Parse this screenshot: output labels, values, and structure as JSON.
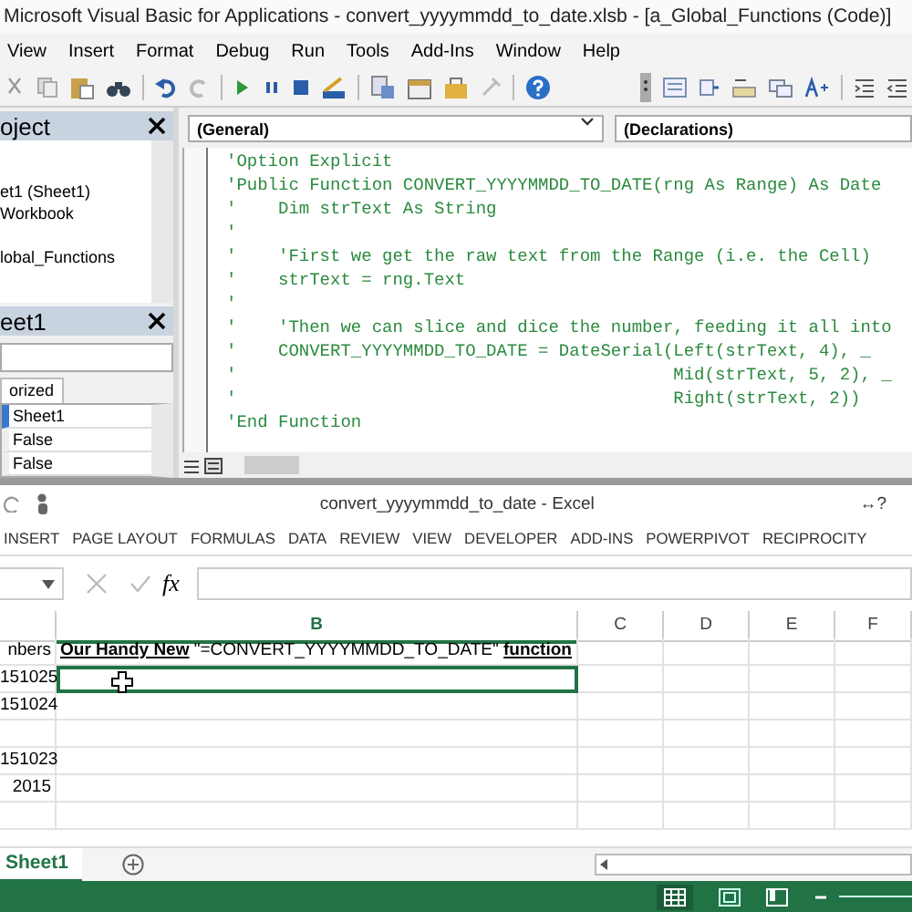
{
  "vba": {
    "title": "Microsoft Visual Basic for Applications - convert_yyyymmdd_to_date.xlsb - [a_Global_Functions (Code)]",
    "menu": [
      "View",
      "Insert",
      "Format",
      "Debug",
      "Run",
      "Tools",
      "Add-Ins",
      "Window",
      "Help"
    ],
    "project": {
      "title": "oject",
      "items": [
        {
          "label": "et1 (Sheet1)"
        },
        {
          "label": "Workbook"
        },
        {
          "label": "lobal_Functions"
        }
      ]
    },
    "properties": {
      "title": "eet1",
      "tab": "orized",
      "rows": [
        {
          "value": "Sheet1",
          "selected": true
        },
        {
          "value": "False",
          "selected": false
        },
        {
          "value": "False",
          "selected": false
        }
      ]
    },
    "code": {
      "object": "(General)",
      "procedure": "(Declarations)",
      "lines": [
        "'Option Explicit",
        "'Public Function CONVERT_YYYYMMDD_TO_DATE(rng As Range) As Date",
        "'    Dim strText As String",
        "'",
        "'    'First we get the raw text from the Range (i.e. the Cell)",
        "'    strText = rng.Text",
        "'",
        "'    'Then we can slice and dice the number, feeding it all into",
        "'    CONVERT_YYYYMMDD_TO_DATE = DateSerial(Left(strText, 4), _",
        "'                                          Mid(strText, 5, 2), _",
        "'                                          Right(strText, 2))",
        "'End Function"
      ]
    }
  },
  "excel": {
    "title": "convert_yyyymmdd_to_date - Excel",
    "help": "↔?",
    "tabs": [
      "INSERT",
      "PAGE LAYOUT",
      "FORMULAS",
      "DATA",
      "REVIEW",
      "VIEW",
      "DEVELOPER",
      "ADD-INS",
      "POWERPIVOT",
      "RECIPROCITY"
    ],
    "fx": "fx",
    "columns": [
      {
        "label": "B",
        "selected": true
      },
      {
        "label": "C",
        "selected": false
      },
      {
        "label": "D",
        "selected": false
      },
      {
        "label": "E",
        "selected": false
      },
      {
        "label": "F",
        "selected": false
      }
    ],
    "rows": [
      {
        "a": "nbers",
        "b": "**Our Handy New** \"=CONVERT_YYYYMMDD_TO_DATE\" **function**",
        "selected": false
      },
      {
        "a": "151025",
        "selected": true
      },
      {
        "a": "151024",
        "selected": false
      },
      {
        "selected": false
      },
      {
        "a": "151023",
        "selected": false
      },
      {
        "a": "2015",
        "selected": false
      },
      {
        "selected": false
      }
    ],
    "sheets": [
      {
        "label": "Sheet1",
        "selected": true
      }
    ]
  }
}
